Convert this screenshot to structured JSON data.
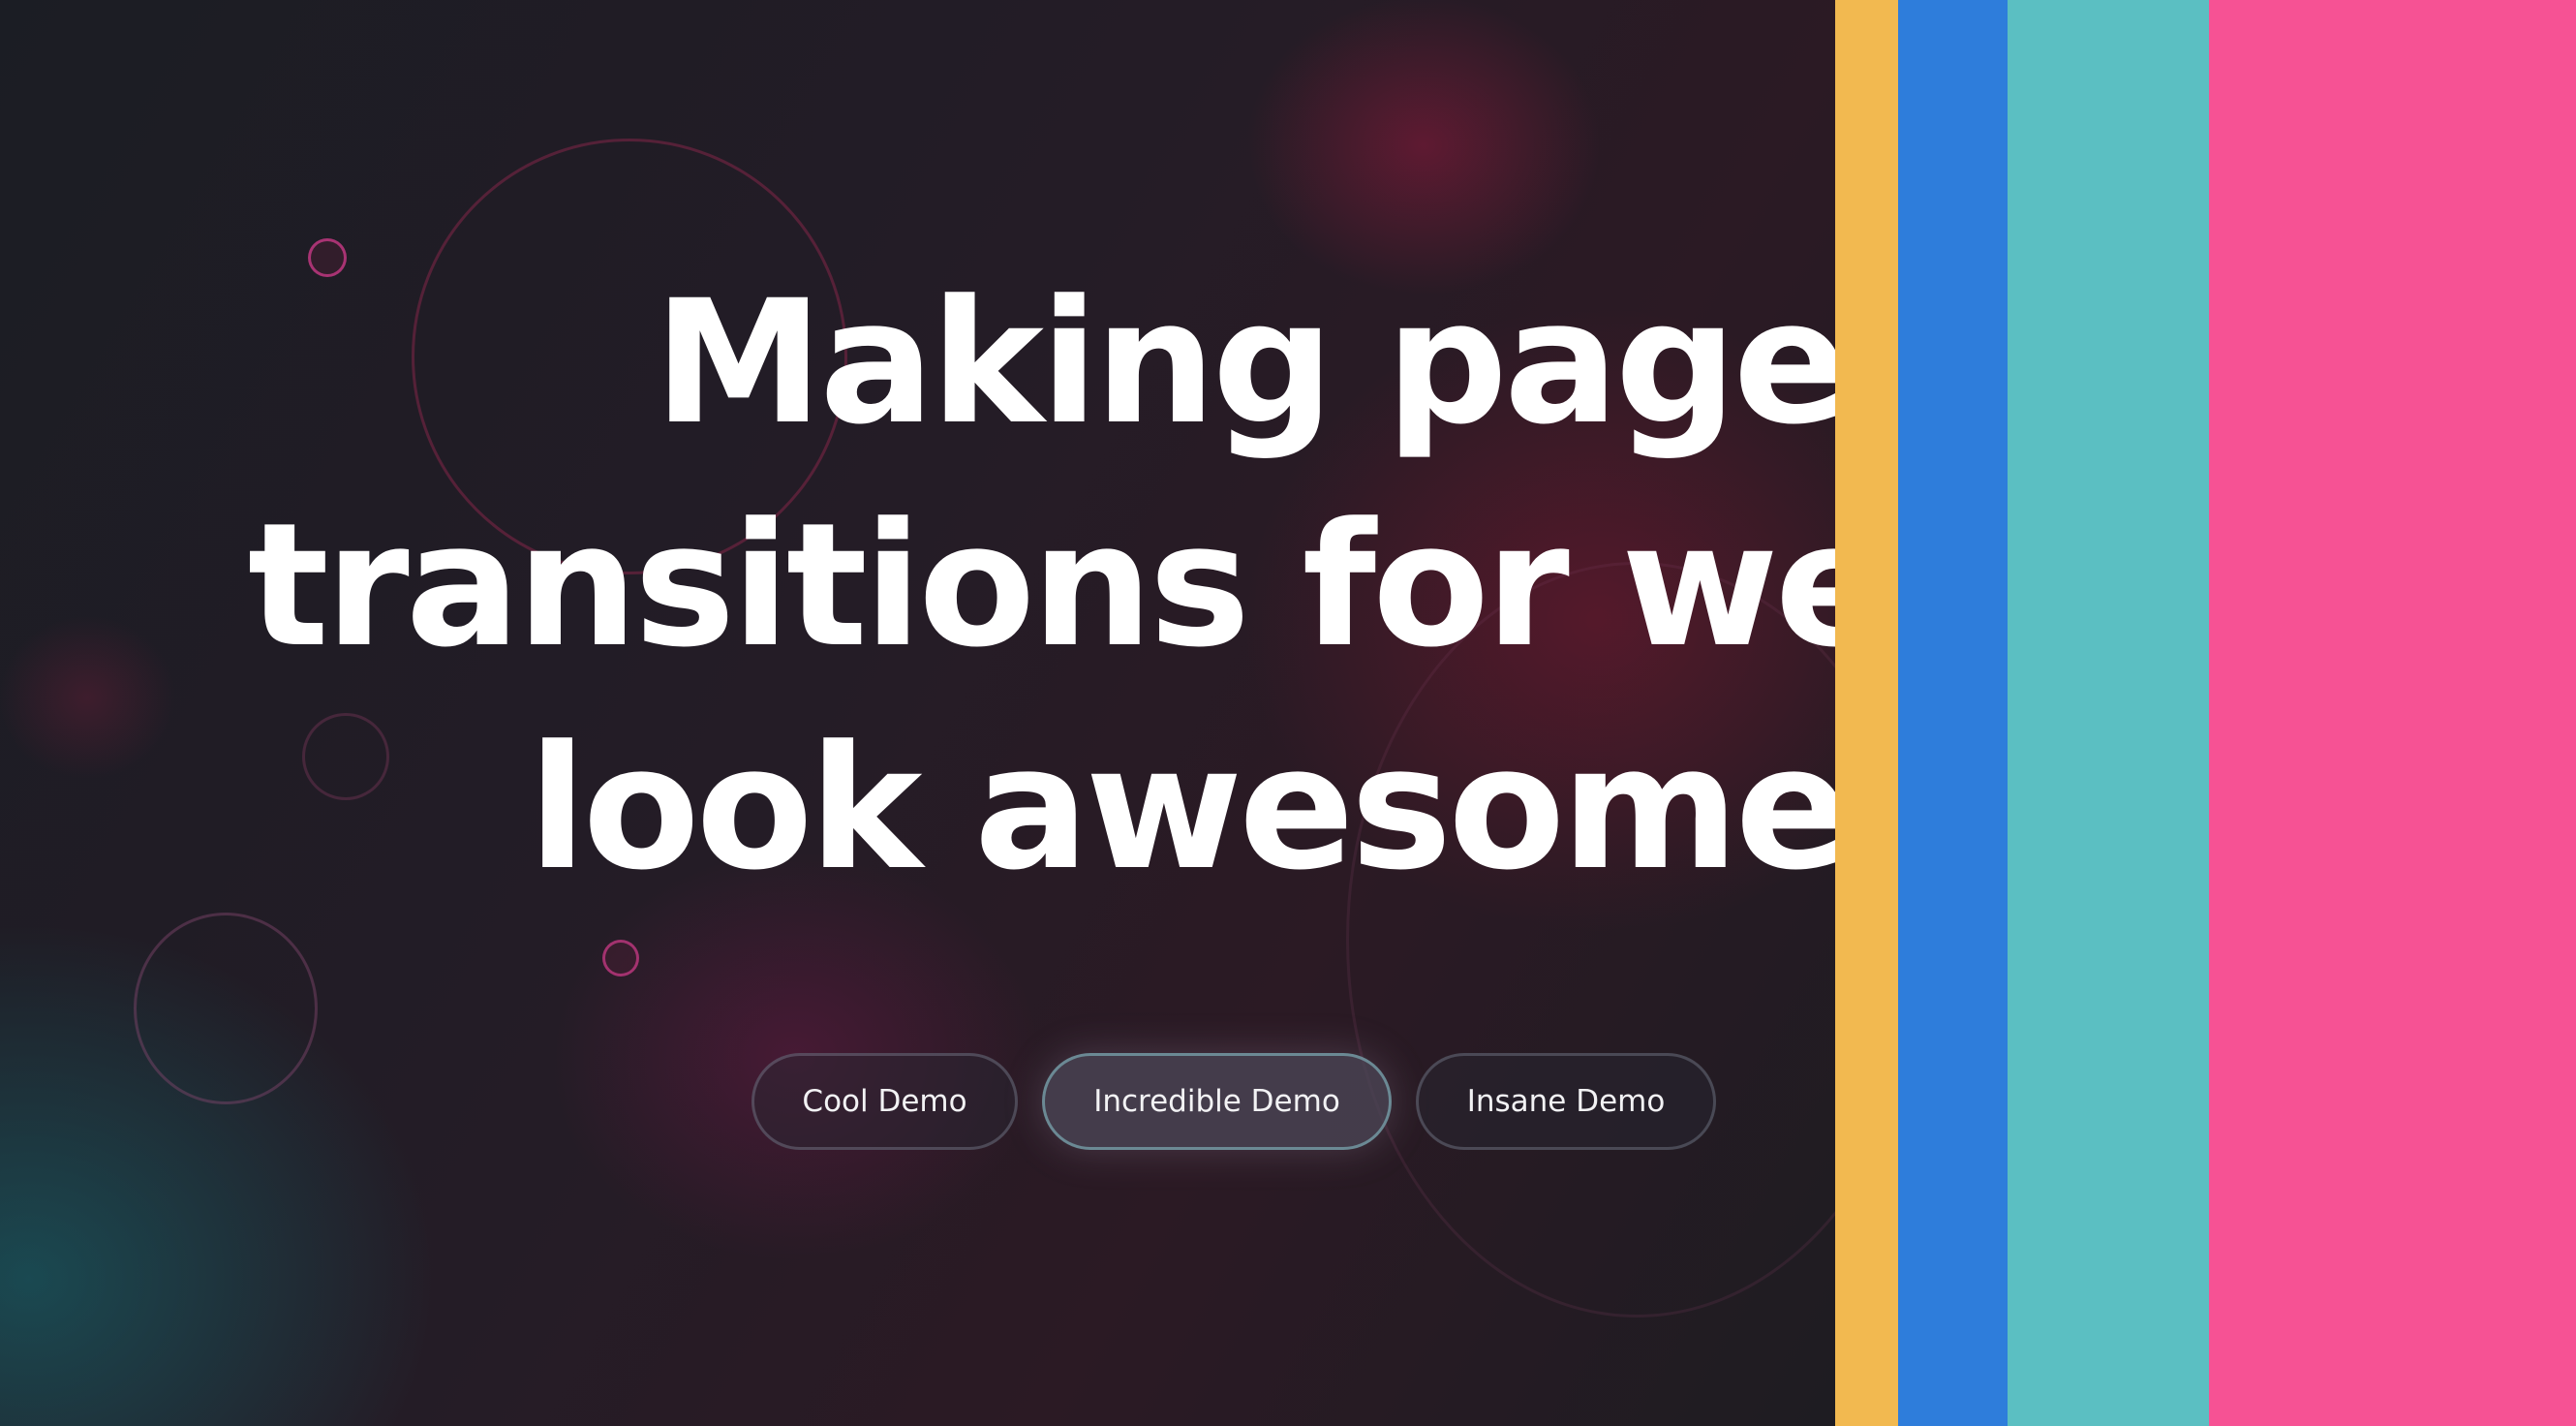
{
  "hero": {
    "heading_lines": [
      "Making page",
      "transitions for web",
      "look awesome"
    ]
  },
  "demos": {
    "items": [
      {
        "label": "Cool Demo",
        "active": false
      },
      {
        "label": "Incredible Demo",
        "active": true
      },
      {
        "label": "Insane Demo",
        "active": false
      }
    ]
  },
  "transition_stripes": {
    "colors": [
      "#f2b950",
      "#2e7ddb",
      "#5bbfc2",
      "#f65294"
    ]
  },
  "theme": {
    "background": "#1b1c22",
    "heading_color": "#ffffff",
    "button_text_color": "#f2f2f4"
  }
}
